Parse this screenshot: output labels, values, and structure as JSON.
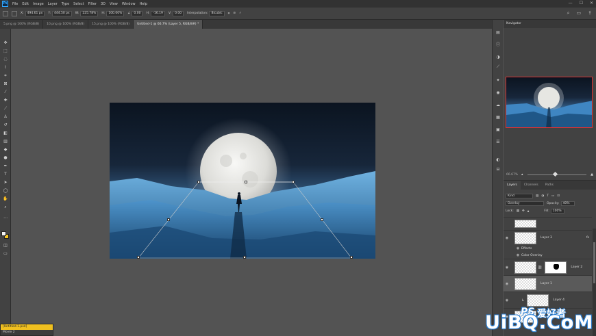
{
  "app": {
    "logo": "Ps"
  },
  "menu": [
    "File",
    "Edit",
    "Image",
    "Layer",
    "Type",
    "Select",
    "Filter",
    "3D",
    "View",
    "Window",
    "Help"
  ],
  "window_controls": [
    "—",
    "☐",
    "✕"
  ],
  "options": {
    "x_label": "X:",
    "x_value": "494.61 px",
    "y_label": "Y:",
    "y_value": "444.50 px",
    "w_label": "W:",
    "w_value": "225.78%",
    "h_label": "H:",
    "h_value": "100.00%",
    "angle_label": "∠",
    "angle_value": "0.00",
    "hskew_label": "H:",
    "hskew_value": "-16.19",
    "vskew_label": "V:",
    "vskew_value": "0.00",
    "interpolation_label": "Interpolation:",
    "interpolation_value": "Bicubic"
  },
  "tabs": [
    {
      "label": "5.png @ 100% (RGB/8)"
    },
    {
      "label": "10.png @ 100% (RGB/8)"
    },
    {
      "label": "15.png @ 100% (RGB/8)"
    },
    {
      "label": "Untitled-1 @ 66.7% (Layer 5, RGB/8#) *"
    }
  ],
  "navigator": {
    "tab": "Navigator",
    "zoom": "66.67%"
  },
  "layers_panel": {
    "tabs": [
      "Layers",
      "Channels",
      "Paths"
    ],
    "search": "Kind",
    "blend_mode": "Overlay",
    "opacity_label": "Opacity:",
    "opacity_value": "40%",
    "lock_label": "Lock:",
    "fill_label": "Fill:",
    "fill_value": "100%",
    "layers": [
      {
        "name": ""
      },
      {
        "name": "Layer 3",
        "fx": "fx",
        "effects": "Effects",
        "effect_item": "Color Overlay"
      },
      {
        "name": "Layer 2"
      },
      {
        "name": "Layer 1"
      },
      {
        "name": "Layer 4"
      }
    ]
  },
  "history": {
    "items": [
      "[Untitled-1.psd]",
      "Movie 2"
    ]
  },
  "watermark": {
    "ps": "PS",
    "cn": "爱好者",
    "main": "UiBQ.CoM"
  },
  "colors": {
    "foreground": "#f4f4f4",
    "background": "#f7c520",
    "accent": "#31a8ff"
  },
  "tool_icons": [
    "move-icon",
    "marquee-icon",
    "lasso-icon",
    "quick-select-icon",
    "crop-icon",
    "frame-icon",
    "eyedropper-icon",
    "healing-icon",
    "brush-icon",
    "stamp-icon",
    "history-brush-icon",
    "eraser-icon",
    "gradient-icon",
    "blur-icon",
    "dodge-icon",
    "pen-icon",
    "type-icon",
    "path-select-icon",
    "shape-icon",
    "hand-icon",
    "zoom-icon",
    "more-icon"
  ]
}
